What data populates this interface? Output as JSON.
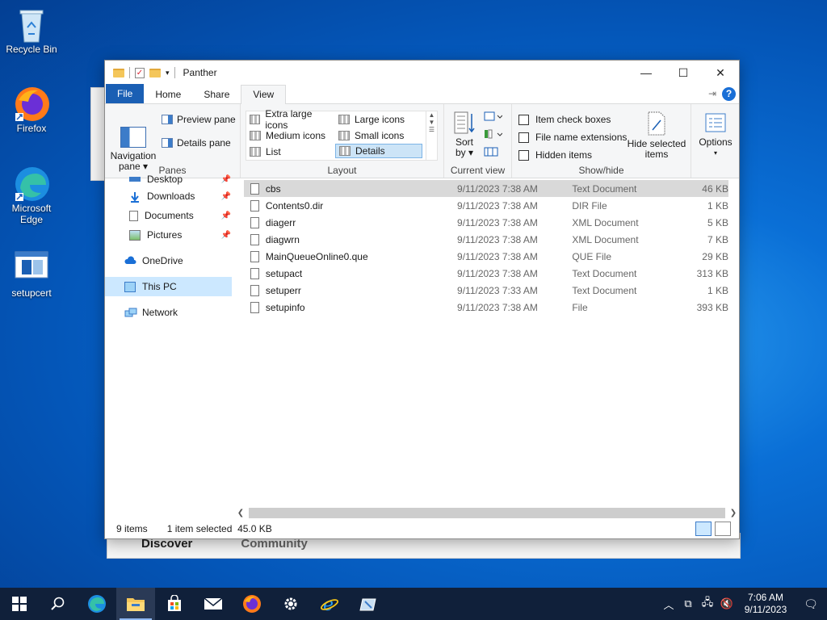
{
  "desktop": {
    "icons": [
      {
        "label": "Recycle Bin"
      },
      {
        "label": "Firefox"
      },
      {
        "label": "Microsoft Edge"
      },
      {
        "label": "setupcert"
      }
    ]
  },
  "background_window": {
    "tabs": [
      "Discover",
      "Community"
    ]
  },
  "window": {
    "title": "Panther",
    "controls": {
      "minimize": "—",
      "maximize": "☐",
      "close": "✕"
    },
    "ribbon_tabs": [
      "File",
      "Home",
      "Share",
      "View"
    ],
    "active_tab": "View",
    "ribbon": {
      "panes": {
        "navigation_pane": "Navigation pane",
        "preview_pane": "Preview pane",
        "details_pane": "Details pane",
        "group": "Panes"
      },
      "layout": {
        "items": [
          "Extra large icons",
          "Large icons",
          "Medium icons",
          "Small icons",
          "List",
          "Details"
        ],
        "selected": "Details",
        "group": "Layout"
      },
      "current_view": {
        "sort_by": "Sort by",
        "group": "Current view"
      },
      "show_hide": {
        "item_check_boxes": "Item check boxes",
        "file_name_extensions": "File name extensions",
        "hidden_items": "Hidden items",
        "hide_selected_items": "Hide selected items",
        "group": "Show/hide"
      },
      "options": "Options"
    },
    "nav_pane": {
      "items": [
        {
          "label": "Desktop",
          "pinned": true
        },
        {
          "label": "Downloads",
          "pinned": true
        },
        {
          "label": "Documents",
          "pinned": true
        },
        {
          "label": "Pictures",
          "pinned": true
        },
        {
          "label": "OneDrive",
          "pinned": false
        },
        {
          "label": "This PC",
          "pinned": false
        },
        {
          "label": "Network",
          "pinned": false
        }
      ],
      "selected": "This PC"
    },
    "files": [
      {
        "name": "cbs",
        "date": "9/11/2023 7:38 AM",
        "type": "Text Document",
        "size": "46 KB"
      },
      {
        "name": "Contents0.dir",
        "date": "9/11/2023 7:38 AM",
        "type": "DIR File",
        "size": "1 KB"
      },
      {
        "name": "diagerr",
        "date": "9/11/2023 7:38 AM",
        "type": "XML Document",
        "size": "5 KB"
      },
      {
        "name": "diagwrn",
        "date": "9/11/2023 7:38 AM",
        "type": "XML Document",
        "size": "7 KB"
      },
      {
        "name": "MainQueueOnline0.que",
        "date": "9/11/2023 7:38 AM",
        "type": "QUE File",
        "size": "29 KB"
      },
      {
        "name": "setupact",
        "date": "9/11/2023 7:38 AM",
        "type": "Text Document",
        "size": "313 KB"
      },
      {
        "name": "setuperr",
        "date": "9/11/2023 7:33 AM",
        "type": "Text Document",
        "size": "1 KB"
      },
      {
        "name": "setupinfo",
        "date": "9/11/2023 7:38 AM",
        "type": "File",
        "size": "393 KB"
      }
    ],
    "selected_file": "cbs",
    "status": {
      "count": "9 items",
      "selection": "1 item selected  45.0 KB"
    }
  },
  "taskbar": {
    "clock_time": "7:06 AM",
    "clock_date": "9/11/2023"
  },
  "colors": {
    "accent": "#1a5fb4",
    "selection": "#cce8ff",
    "taskbar": "#10203a"
  }
}
